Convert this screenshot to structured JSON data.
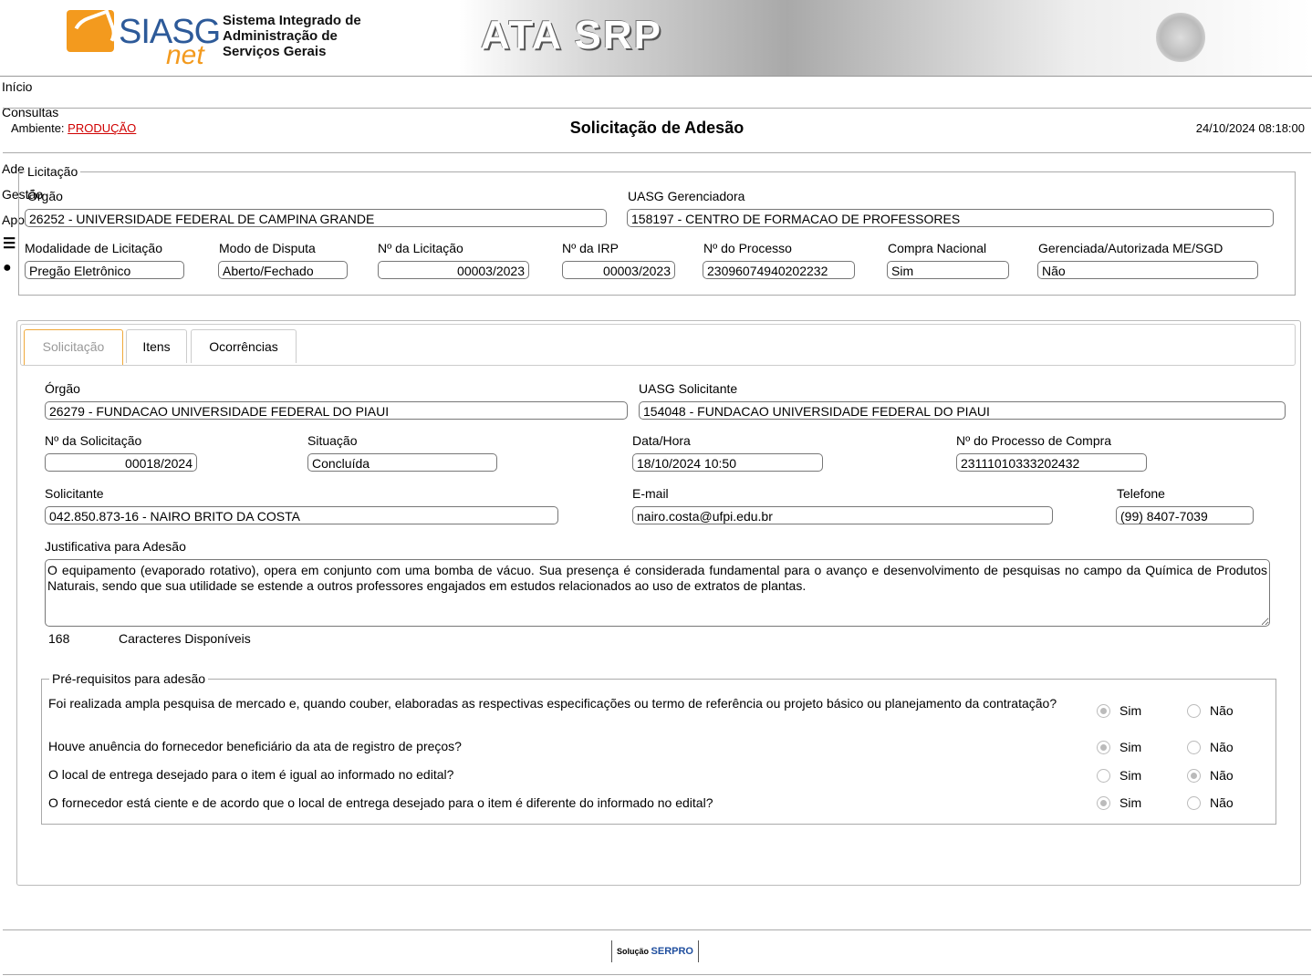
{
  "header": {
    "logo_text": "SIASG",
    "logo_sub": "net",
    "system_name": "Sistema Integrado de\nAdministração de\nServiços Gerais",
    "banner_title": "ATA SRP"
  },
  "menu": {
    "items": [
      "Início",
      "Consultas",
      "Adesão",
      "Gestão",
      "Apoio"
    ],
    "icons": [
      "menu-icon",
      "user-icon"
    ]
  },
  "infobar": {
    "ambiente_label": "Ambiente:",
    "ambiente_value": "PRODUÇÃO",
    "title": "Solicitação de Adesão",
    "datetime": "24/10/2024 08:18:00"
  },
  "licitacao": {
    "legend": "Licitação",
    "orgao_label": "Órgão",
    "orgao": "26252 - UNIVERSIDADE FEDERAL DE CAMPINA GRANDE",
    "uasg_label": "UASG Gerenciadora",
    "uasg": "158197 - CENTRO DE FORMACAO DE PROFESSORES",
    "modalidade_label": "Modalidade de Licitação",
    "modalidade": "Pregão Eletrônico",
    "modo_label": "Modo de Disputa",
    "modo": "Aberto/Fechado",
    "num_licitacao_label": "Nº da Licitação",
    "num_licitacao": "00003/2023",
    "num_irp_label": "Nº da IRP",
    "num_irp": "00003/2023",
    "num_processo_label": "Nº do Processo",
    "num_processo": "23096074940202232",
    "compra_nacional_label": "Compra Nacional",
    "compra_nacional": "Sim",
    "gerenciada_label": "Gerenciada/Autorizada ME/SGD",
    "gerenciada": "Não"
  },
  "tabs": [
    "Solicitação",
    "Itens",
    "Ocorrências"
  ],
  "solicitacao": {
    "orgao_label": "Órgão",
    "orgao": "26279 - FUNDACAO UNIVERSIDADE FEDERAL DO PIAUI",
    "uasg_label": "UASG Solicitante",
    "uasg": "154048 - FUNDACAO UNIVERSIDADE FEDERAL DO PIAUI",
    "num_label": "Nº da Solicitação",
    "num": "00018/2024",
    "situacao_label": "Situação",
    "situacao": "Concluída",
    "datahora_label": "Data/Hora",
    "datahora": "18/10/2024 10:50",
    "processo_label": "Nº do Processo de Compra",
    "processo": "23111010333202432",
    "solicitante_label": "Solicitante",
    "solicitante": "042.850.873-16 - NAIRO BRITO DA COSTA",
    "email_label": "E-mail",
    "email": "nairo.costa@ufpi.edu.br",
    "telefone_label": "Telefone",
    "telefone": "(99) 8407-7039",
    "justificativa_label": "Justificativa para Adesão",
    "justificativa": "O equipamento (evaporado rotativo), opera em conjunto com uma bomba de vácuo. Sua presença é considerada fundamental para o avanço e desenvolvimento de pesquisas no campo da Química de Produtos Naturais, sendo que sua utilidade se estende a outros professores engajados em estudos relacionados ao uso de extratos de plantas.",
    "chars_count": "168",
    "chars_label": "Caracteres Disponíveis"
  },
  "prereq": {
    "legend": "Pré-requisitos para adesão",
    "yes_label": "Sim",
    "no_label": "Não",
    "questions": [
      {
        "text": "Foi realizada ampla pesquisa de mercado e, quando couber, elaboradas as respectivas especificações ou termo de referência ou projeto básico ou planejamento da contratação?",
        "answer": "Sim"
      },
      {
        "text": "Houve anuência do fornecedor beneficiário da ata de registro de preços?",
        "answer": "Sim"
      },
      {
        "text": "O local de entrega desejado para o item é igual ao informado no edital?",
        "answer": "Não"
      },
      {
        "text": "O fornecedor está ciente e de acordo que o local de entrega desejado para o item é diferente do informado no edital?",
        "answer": "Sim"
      }
    ]
  },
  "footer": {
    "prefix": "Solução",
    "brand": "SERPRO"
  }
}
